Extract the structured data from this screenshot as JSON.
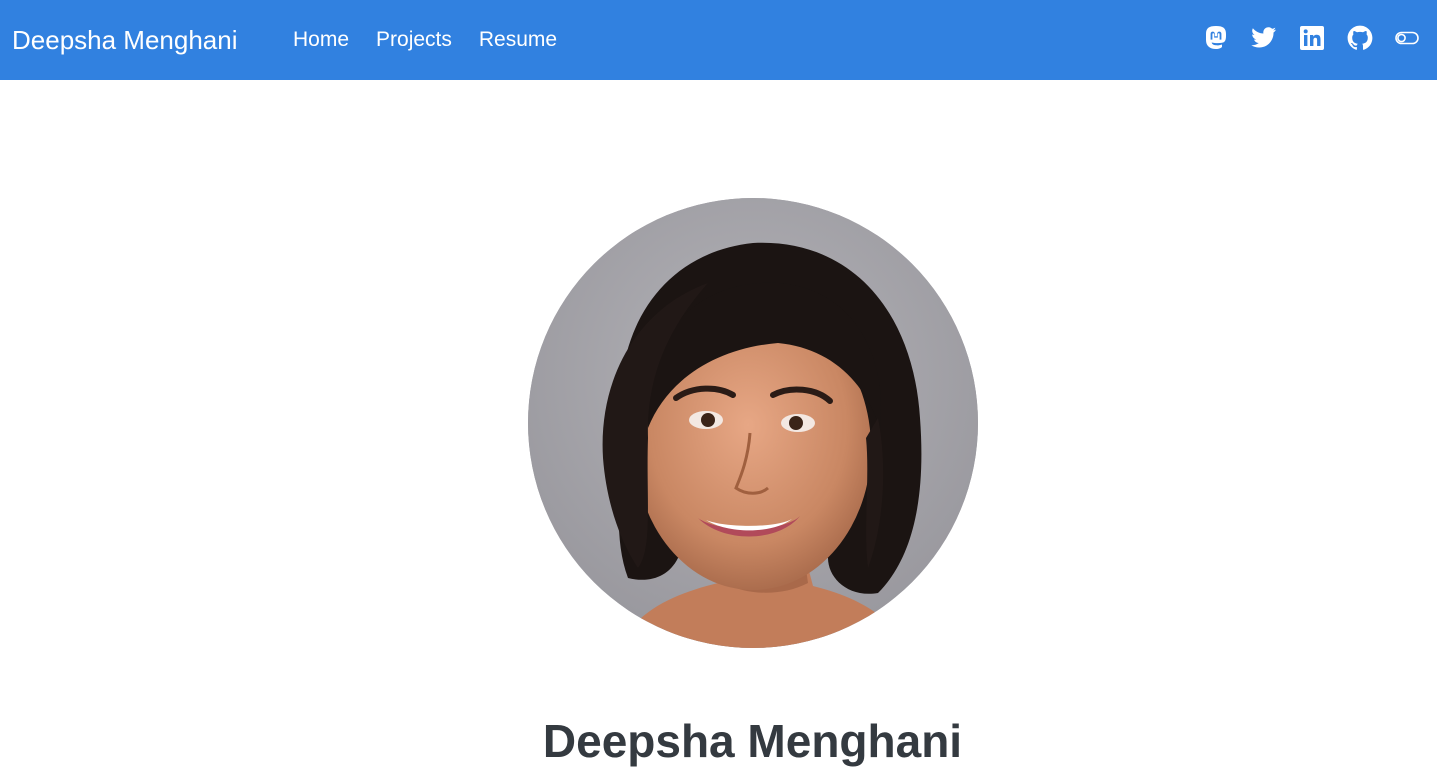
{
  "navbar": {
    "brand": "Deepsha Menghani",
    "links": [
      {
        "label": "Home"
      },
      {
        "label": "Projects"
      },
      {
        "label": "Resume"
      }
    ],
    "icons": [
      "mastodon-icon",
      "twitter-icon",
      "linkedin-icon",
      "github-icon",
      "theme-toggle-icon"
    ],
    "background_color": "#3181e0"
  },
  "profile": {
    "name": "Deepsha Menghani",
    "photo": "portrait-photo"
  }
}
